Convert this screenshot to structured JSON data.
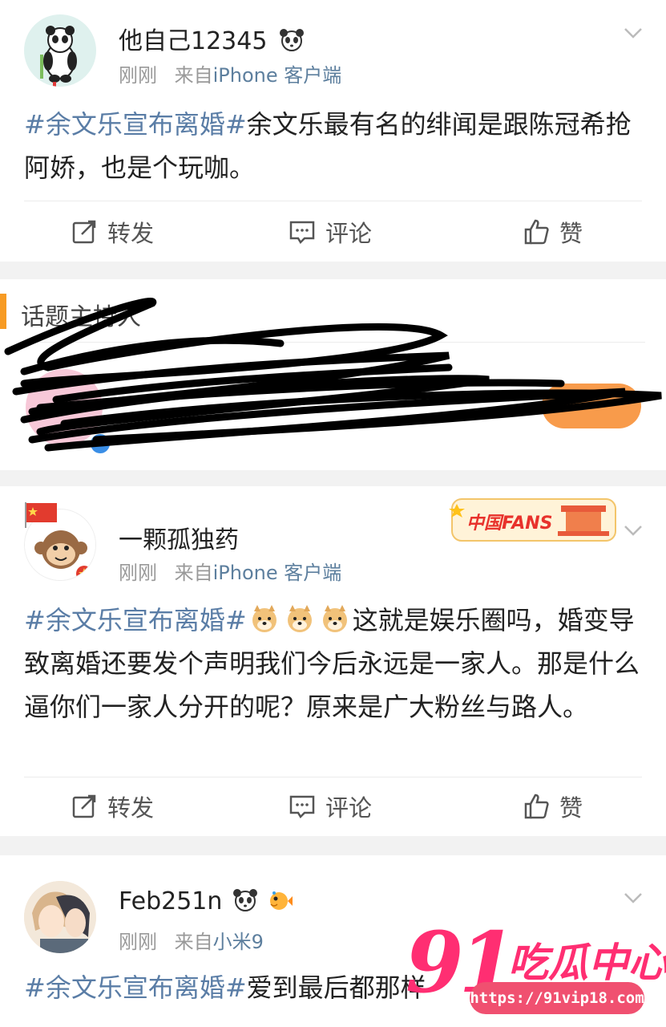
{
  "posts": [
    {
      "username": "他自己12345",
      "time": "刚刚",
      "source_prefix": "来自",
      "source": "iPhone 客户端",
      "hashtag": "#余文乐宣布离婚#",
      "text": "余文乐最有名的绯闻是跟陈冠希抢阿娇，也是个玩咖。"
    },
    {
      "username": "一颗孤独药",
      "time": "刚刚",
      "source_prefix": "来自",
      "source": "iPhone 客户端",
      "hashtag": "#余文乐宣布离婚#",
      "text": "这就是娱乐圈吗，婚变导致离婚还要发个声明我们今后永远是一家人。那是什么逼你们一家人分开的呢？原来是广大粉丝与路人。",
      "badge": "中国FANS"
    },
    {
      "username": "Feb251n",
      "time": "刚刚",
      "source_prefix": "来自",
      "source": "小米9",
      "hashtag": "#余文乐宣布离婚#",
      "text": "爱到最后都那样"
    }
  ],
  "actions": {
    "repost": "转发",
    "comment": "评论",
    "like": "赞"
  },
  "topic_host": {
    "label": "话题主持人"
  },
  "watermark": {
    "number": "91",
    "text": "吃瓜中心",
    "url": "https://91vip18.com"
  },
  "colors": {
    "hashtag": "#5a7da6",
    "accent": "#f79b24",
    "watermark": "#ff2e72"
  }
}
